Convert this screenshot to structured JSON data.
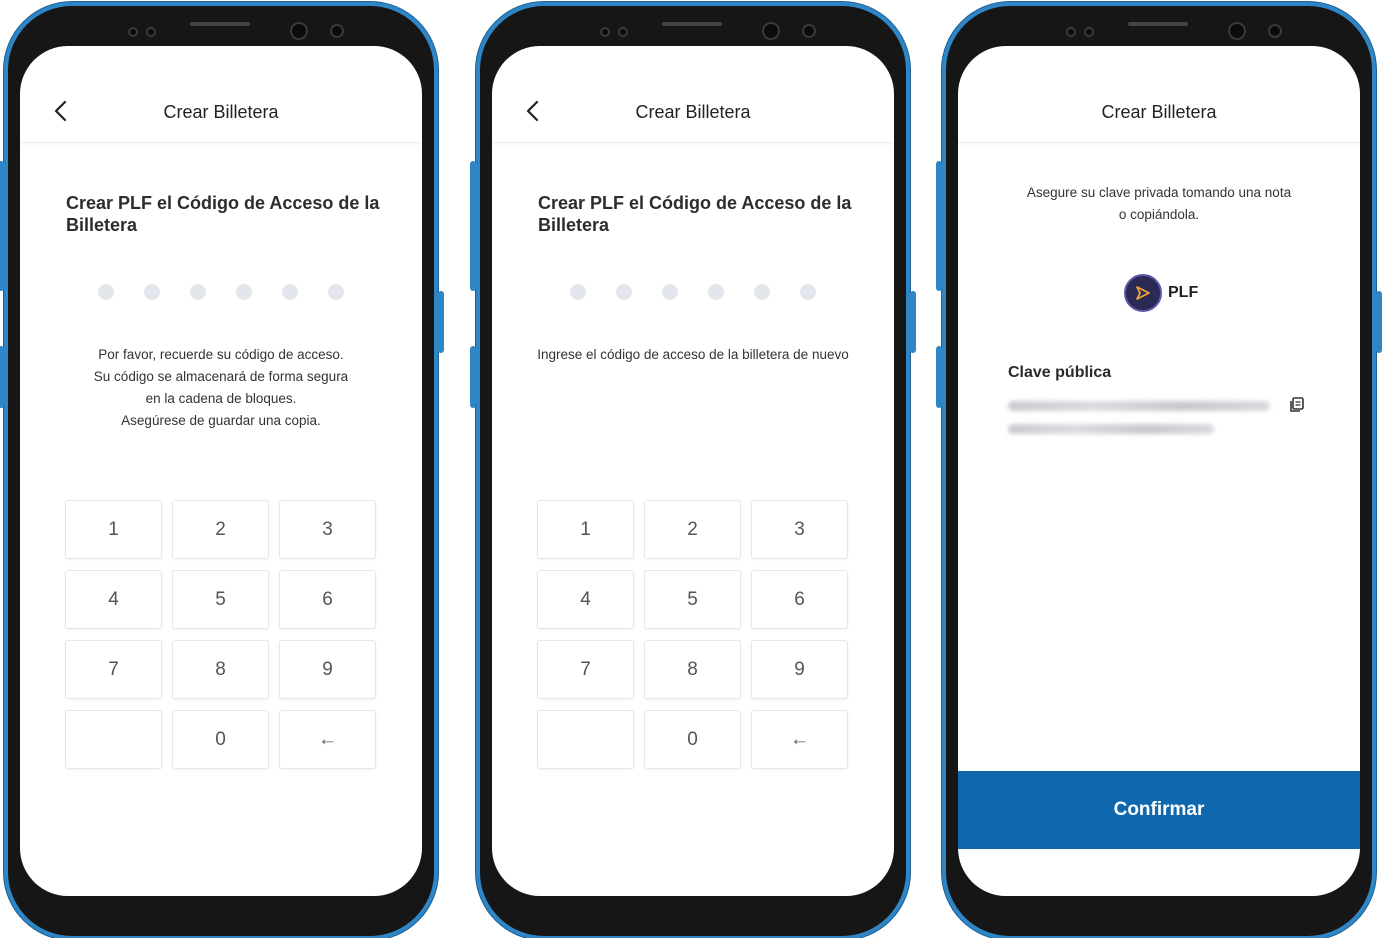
{
  "screens": [
    {
      "title": "Crear Billetera",
      "heading": "Crear PLF el Código de Acceso de la Billetera",
      "message": [
        "Por favor, recuerde su código de acceso.",
        "Su código  se almacenará de forma segura",
        "en la cadena de bloques.",
        "Asegúrese de guardar una copia."
      ],
      "keys": [
        "1",
        "2",
        "3",
        "4",
        "5",
        "6",
        "7",
        "8",
        "9",
        "",
        "0",
        "←"
      ]
    },
    {
      "title": "Crear Billetera",
      "heading": "Crear PLF el Código de Acceso de la Billetera",
      "message": [
        "Ingrese el código de acceso de la billetera de nuevo"
      ],
      "keys": [
        "1",
        "2",
        "3",
        "4",
        "5",
        "6",
        "7",
        "8",
        "9",
        "",
        "0",
        "←"
      ]
    },
    {
      "title": "Crear Billetera",
      "message": [
        "Asegure su clave privada tomando una nota",
        "o copiándola."
      ],
      "coin_name": "PLF",
      "public_key_label": "Clave pública",
      "confirm_label": "Confirmar"
    }
  ],
  "icons": {
    "back": "chevron-left-icon",
    "copy": "copy-icon",
    "backspace": "arrow-left-icon",
    "coin": "plf-logo-icon"
  },
  "colors": {
    "frame_accent": "#2f86c6",
    "primary_button": "#0f68ad",
    "dot_inactive": "#e3e6ec"
  }
}
